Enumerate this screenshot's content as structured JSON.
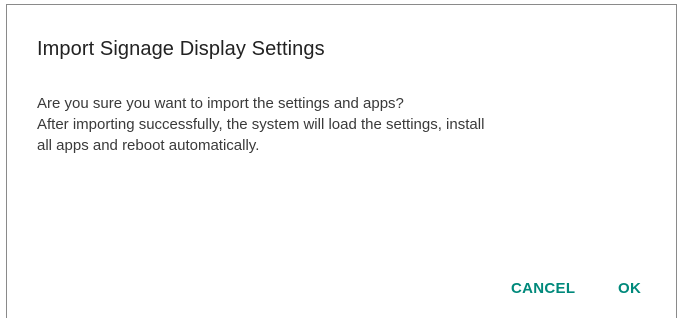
{
  "dialog": {
    "title": "Import Signage Display Settings",
    "message_lines": [
      "Are you sure you want to import the settings and apps?",
      "After importing successfully, the system will load the settings, install",
      "all apps and reboot automatically."
    ],
    "buttons": {
      "cancel": "CANCEL",
      "ok": "OK"
    }
  },
  "colors": {
    "accent": "#00897b",
    "title_text": "#222222",
    "body_text": "#3a3a3a",
    "background": "#ffffff"
  }
}
